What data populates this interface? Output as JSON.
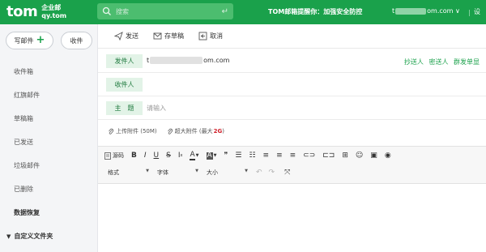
{
  "header": {
    "logo": "tom",
    "logo_line1": "企业邮",
    "logo_line2": "qy.tom",
    "search_placeholder": "搜索",
    "notice": "TOM邮箱提醒你：加强安全防控",
    "account_prefix": "t",
    "account_suffix": "om.com ∨",
    "separator": "|",
    "settings": "设"
  },
  "sidebar": {
    "write_label": "写邮件",
    "inbox_label": "收件",
    "items": [
      {
        "label": "收件箱"
      },
      {
        "label": "红旗邮件"
      },
      {
        "label": "草稿箱"
      },
      {
        "label": "已发送"
      },
      {
        "label": "垃圾邮件"
      },
      {
        "label": "已删除"
      },
      {
        "label": "数据恢复"
      },
      {
        "label": "自定义文件夹"
      }
    ]
  },
  "toolbar": {
    "send": "发送",
    "save_draft": "存草稿",
    "cancel": "取消"
  },
  "compose": {
    "sender_label": "发件人",
    "sender_prefix": "t",
    "sender_suffix": "om.com",
    "recipient_label": "收件人",
    "subject_label": "主　题",
    "subject_placeholder": "请输入",
    "opt_cc": "抄送人",
    "opt_bcc": "密送人",
    "opt_group": "群发单显"
  },
  "attachments": {
    "upload": "上传附件 (50M)",
    "large_prefix": "超大附件 (最大",
    "large_size": "2G",
    "large_suffix": ")"
  },
  "editor": {
    "source": "源码",
    "format": "格式",
    "font": "字体",
    "size": "大小",
    "color_accent": "#1aa14b"
  }
}
